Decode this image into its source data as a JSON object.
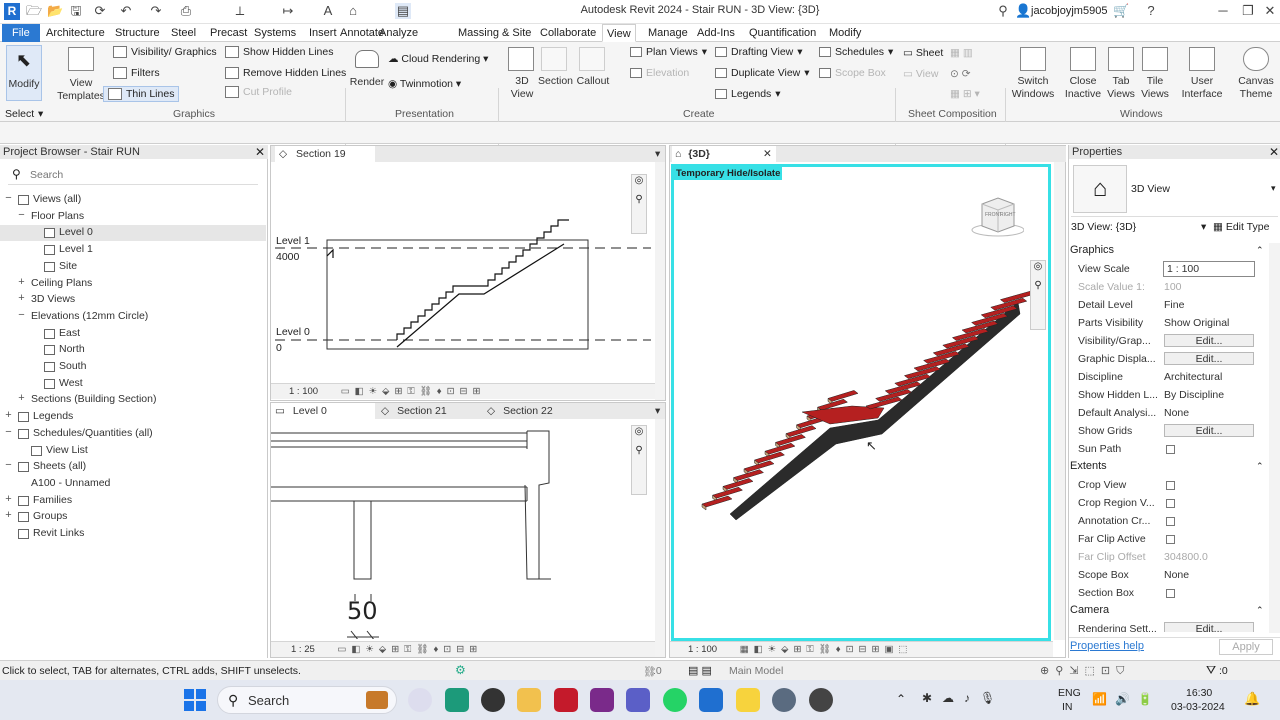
{
  "app": {
    "title": "Autodesk Revit 2024 - Stair RUN - 3D View: {3D}",
    "logo": "R",
    "user": "jacobjoyjm5905"
  },
  "colors": {
    "accent": "#2b79d2",
    "highlight": "#37e0e6",
    "stair_tread": "#b52020",
    "stair_riser": "#c9a27a"
  },
  "menu": [
    "File",
    "Architecture",
    "Structure",
    "Steel",
    "Precast",
    "Systems",
    "Insert",
    "Annotate",
    "Analyze",
    "Massing & Site",
    "Collaborate",
    "View",
    "Manage",
    "Add-Ins",
    "Quantification",
    "Modify"
  ],
  "menu_active": "View",
  "ribbon": {
    "modify": "Modify",
    "select": "Select",
    "view_templates": "View Templates",
    "graphics_items": [
      "Visibility/ Graphics",
      "Filters",
      "Thin Lines",
      "Show Hidden Lines",
      "Remove Hidden Lines",
      "Cut Profile"
    ],
    "graphics_label": "Graphics",
    "render": "Render",
    "cloud_rendering": "Cloud Rendering",
    "twinmotion": "Twinmotion",
    "presentation_label": "Presentation",
    "create_big": [
      "3D View",
      "Section",
      "Callout"
    ],
    "create_items": [
      "Plan Views",
      "Elevation",
      "Drafting View",
      "Duplicate View",
      "Legends",
      "Schedules",
      "Scope Box"
    ],
    "create_label": "Create",
    "sheet": "Sheet",
    "sheet_view": "View",
    "sheet_label": "Sheet Composition",
    "windows": [
      "Switch Windows",
      "Close Inactive",
      "Tab Views",
      "Tile Views"
    ],
    "windows_label": "Windows",
    "user_interface": "User Interface",
    "canvas_theme": "Canvas Theme"
  },
  "project_browser": {
    "title": "Project Browser - Stair RUN",
    "search_placeholder": "Search",
    "items": [
      {
        "label": "Views (all)",
        "toggle": "−",
        "indent": 0,
        "icon": true
      },
      {
        "label": "Floor Plans",
        "toggle": "−",
        "indent": 1,
        "icon": false
      },
      {
        "label": "Level 0",
        "toggle": "",
        "indent": 2,
        "icon": true,
        "selected": true
      },
      {
        "label": "Level 1",
        "toggle": "",
        "indent": 2,
        "icon": true
      },
      {
        "label": "Site",
        "toggle": "",
        "indent": 2,
        "icon": true
      },
      {
        "label": "Ceiling Plans",
        "toggle": "+",
        "indent": 1,
        "icon": false
      },
      {
        "label": "3D Views",
        "toggle": "+",
        "indent": 1,
        "icon": false
      },
      {
        "label": "Elevations (12mm Circle)",
        "toggle": "−",
        "indent": 1,
        "icon": false
      },
      {
        "label": "East",
        "toggle": "",
        "indent": 2,
        "icon": true
      },
      {
        "label": "North",
        "toggle": "",
        "indent": 2,
        "icon": true
      },
      {
        "label": "South",
        "toggle": "",
        "indent": 2,
        "icon": true
      },
      {
        "label": "West",
        "toggle": "",
        "indent": 2,
        "icon": true
      },
      {
        "label": "Sections (Building Section)",
        "toggle": "+",
        "indent": 1,
        "icon": false
      },
      {
        "label": "Legends",
        "toggle": "+",
        "indent": 0,
        "icon": true
      },
      {
        "label": "Schedules/Quantities (all)",
        "toggle": "−",
        "indent": 0,
        "icon": true
      },
      {
        "label": "View List",
        "toggle": "",
        "indent": 1,
        "icon": true
      },
      {
        "label": "Sheets (all)",
        "toggle": "−",
        "indent": 0,
        "icon": true
      },
      {
        "label": "A100 - Unnamed",
        "toggle": "",
        "indent": 1,
        "icon": false
      },
      {
        "label": "Families",
        "toggle": "+",
        "indent": 0,
        "icon": true
      },
      {
        "label": "Groups",
        "toggle": "+",
        "indent": 0,
        "icon": true
      },
      {
        "label": "Revit Links",
        "toggle": "",
        "indent": 0,
        "icon": true
      }
    ]
  },
  "views": {
    "section19": {
      "tab": "Section 19",
      "scale": "1 : 100",
      "level1": "Level 1",
      "level1_elev": "4000",
      "level0": "Level 0",
      "level0_elev": "0"
    },
    "level0_tabs": [
      "Level 0",
      "Section 21",
      "Section 22"
    ],
    "level0_view": {
      "scale": "1 : 25",
      "dimension": "50"
    },
    "view3d": {
      "tab": "{3D}",
      "badge": "Temporary Hide/Isolate",
      "scale": "1 : 100",
      "cube_left": "FRONT",
      "cube_right": "RIGHT"
    }
  },
  "properties": {
    "title": "Properties",
    "type_name": "3D View",
    "instance": "3D View: {3D}",
    "edit_type": "Edit Type",
    "sections": [
      {
        "name": "Graphics",
        "rows": [
          {
            "k": "View Scale",
            "v": "1 : 100",
            "kind": "input"
          },
          {
            "k": "Scale Value    1:",
            "v": "100",
            "kind": "dis"
          },
          {
            "k": "Detail Level",
            "v": "Fine",
            "kind": "text"
          },
          {
            "k": "Parts Visibility",
            "v": "Show Original",
            "kind": "text"
          },
          {
            "k": "Visibility/Grap...",
            "v": "Edit...",
            "kind": "btn"
          },
          {
            "k": "Graphic Displa...",
            "v": "Edit...",
            "kind": "btn"
          },
          {
            "k": "Discipline",
            "v": "Architectural",
            "kind": "text"
          },
          {
            "k": "Show Hidden L...",
            "v": "By Discipline",
            "kind": "text"
          },
          {
            "k": "Default Analysi...",
            "v": "None",
            "kind": "text"
          },
          {
            "k": "Show Grids",
            "v": "Edit...",
            "kind": "btn"
          },
          {
            "k": "Sun Path",
            "v": "",
            "kind": "chk"
          }
        ]
      },
      {
        "name": "Extents",
        "rows": [
          {
            "k": "Crop View",
            "v": "",
            "kind": "chk"
          },
          {
            "k": "Crop Region V...",
            "v": "",
            "kind": "chk"
          },
          {
            "k": "Annotation Cr...",
            "v": "",
            "kind": "chk"
          },
          {
            "k": "Far Clip Active",
            "v": "",
            "kind": "chk"
          },
          {
            "k": "Far Clip Offset",
            "v": "304800.0",
            "kind": "dis"
          },
          {
            "k": "Scope Box",
            "v": "None",
            "kind": "text"
          },
          {
            "k": "Section Box",
            "v": "",
            "kind": "chk"
          }
        ]
      },
      {
        "name": "Camera",
        "rows": [
          {
            "k": "Rendering Sett...",
            "v": "Edit...",
            "kind": "btn"
          }
        ]
      }
    ],
    "help": "Properties help",
    "apply": "Apply"
  },
  "status": {
    "hint": "Click to select, TAB for alternates, CTRL adds, SHIFT unselects.",
    "model": "Main Model",
    "zero1": ":0",
    "zero2": ":0"
  },
  "taskbar": {
    "search": "Search",
    "lang1": "ENG",
    "lang2": "IN",
    "time": "16:30",
    "date": "03-03-2024"
  }
}
